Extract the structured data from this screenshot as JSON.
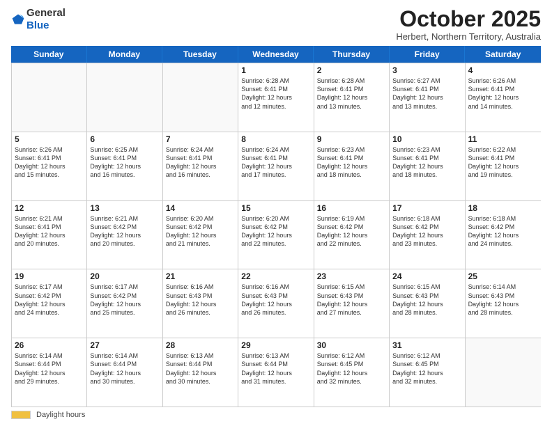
{
  "header": {
    "logo_line1": "General",
    "logo_line2": "Blue",
    "month": "October 2025",
    "location": "Herbert, Northern Territory, Australia"
  },
  "weekdays": [
    "Sunday",
    "Monday",
    "Tuesday",
    "Wednesday",
    "Thursday",
    "Friday",
    "Saturday"
  ],
  "rows": [
    [
      {
        "day": "",
        "info": ""
      },
      {
        "day": "",
        "info": ""
      },
      {
        "day": "",
        "info": ""
      },
      {
        "day": "1",
        "info": "Sunrise: 6:28 AM\nSunset: 6:41 PM\nDaylight: 12 hours\nand 12 minutes."
      },
      {
        "day": "2",
        "info": "Sunrise: 6:28 AM\nSunset: 6:41 PM\nDaylight: 12 hours\nand 13 minutes."
      },
      {
        "day": "3",
        "info": "Sunrise: 6:27 AM\nSunset: 6:41 PM\nDaylight: 12 hours\nand 13 minutes."
      },
      {
        "day": "4",
        "info": "Sunrise: 6:26 AM\nSunset: 6:41 PM\nDaylight: 12 hours\nand 14 minutes."
      }
    ],
    [
      {
        "day": "5",
        "info": "Sunrise: 6:26 AM\nSunset: 6:41 PM\nDaylight: 12 hours\nand 15 minutes."
      },
      {
        "day": "6",
        "info": "Sunrise: 6:25 AM\nSunset: 6:41 PM\nDaylight: 12 hours\nand 16 minutes."
      },
      {
        "day": "7",
        "info": "Sunrise: 6:24 AM\nSunset: 6:41 PM\nDaylight: 12 hours\nand 16 minutes."
      },
      {
        "day": "8",
        "info": "Sunrise: 6:24 AM\nSunset: 6:41 PM\nDaylight: 12 hours\nand 17 minutes."
      },
      {
        "day": "9",
        "info": "Sunrise: 6:23 AM\nSunset: 6:41 PM\nDaylight: 12 hours\nand 18 minutes."
      },
      {
        "day": "10",
        "info": "Sunrise: 6:23 AM\nSunset: 6:41 PM\nDaylight: 12 hours\nand 18 minutes."
      },
      {
        "day": "11",
        "info": "Sunrise: 6:22 AM\nSunset: 6:41 PM\nDaylight: 12 hours\nand 19 minutes."
      }
    ],
    [
      {
        "day": "12",
        "info": "Sunrise: 6:21 AM\nSunset: 6:41 PM\nDaylight: 12 hours\nand 20 minutes."
      },
      {
        "day": "13",
        "info": "Sunrise: 6:21 AM\nSunset: 6:42 PM\nDaylight: 12 hours\nand 20 minutes."
      },
      {
        "day": "14",
        "info": "Sunrise: 6:20 AM\nSunset: 6:42 PM\nDaylight: 12 hours\nand 21 minutes."
      },
      {
        "day": "15",
        "info": "Sunrise: 6:20 AM\nSunset: 6:42 PM\nDaylight: 12 hours\nand 22 minutes."
      },
      {
        "day": "16",
        "info": "Sunrise: 6:19 AM\nSunset: 6:42 PM\nDaylight: 12 hours\nand 22 minutes."
      },
      {
        "day": "17",
        "info": "Sunrise: 6:18 AM\nSunset: 6:42 PM\nDaylight: 12 hours\nand 23 minutes."
      },
      {
        "day": "18",
        "info": "Sunrise: 6:18 AM\nSunset: 6:42 PM\nDaylight: 12 hours\nand 24 minutes."
      }
    ],
    [
      {
        "day": "19",
        "info": "Sunrise: 6:17 AM\nSunset: 6:42 PM\nDaylight: 12 hours\nand 24 minutes."
      },
      {
        "day": "20",
        "info": "Sunrise: 6:17 AM\nSunset: 6:42 PM\nDaylight: 12 hours\nand 25 minutes."
      },
      {
        "day": "21",
        "info": "Sunrise: 6:16 AM\nSunset: 6:43 PM\nDaylight: 12 hours\nand 26 minutes."
      },
      {
        "day": "22",
        "info": "Sunrise: 6:16 AM\nSunset: 6:43 PM\nDaylight: 12 hours\nand 26 minutes."
      },
      {
        "day": "23",
        "info": "Sunrise: 6:15 AM\nSunset: 6:43 PM\nDaylight: 12 hours\nand 27 minutes."
      },
      {
        "day": "24",
        "info": "Sunrise: 6:15 AM\nSunset: 6:43 PM\nDaylight: 12 hours\nand 28 minutes."
      },
      {
        "day": "25",
        "info": "Sunrise: 6:14 AM\nSunset: 6:43 PM\nDaylight: 12 hours\nand 28 minutes."
      }
    ],
    [
      {
        "day": "26",
        "info": "Sunrise: 6:14 AM\nSunset: 6:44 PM\nDaylight: 12 hours\nand 29 minutes."
      },
      {
        "day": "27",
        "info": "Sunrise: 6:14 AM\nSunset: 6:44 PM\nDaylight: 12 hours\nand 30 minutes."
      },
      {
        "day": "28",
        "info": "Sunrise: 6:13 AM\nSunset: 6:44 PM\nDaylight: 12 hours\nand 30 minutes."
      },
      {
        "day": "29",
        "info": "Sunrise: 6:13 AM\nSunset: 6:44 PM\nDaylight: 12 hours\nand 31 minutes."
      },
      {
        "day": "30",
        "info": "Sunrise: 6:12 AM\nSunset: 6:45 PM\nDaylight: 12 hours\nand 32 minutes."
      },
      {
        "day": "31",
        "info": "Sunrise: 6:12 AM\nSunset: 6:45 PM\nDaylight: 12 hours\nand 32 minutes."
      },
      {
        "day": "",
        "info": ""
      }
    ]
  ],
  "footer": {
    "daylight_label": "Daylight hours"
  }
}
